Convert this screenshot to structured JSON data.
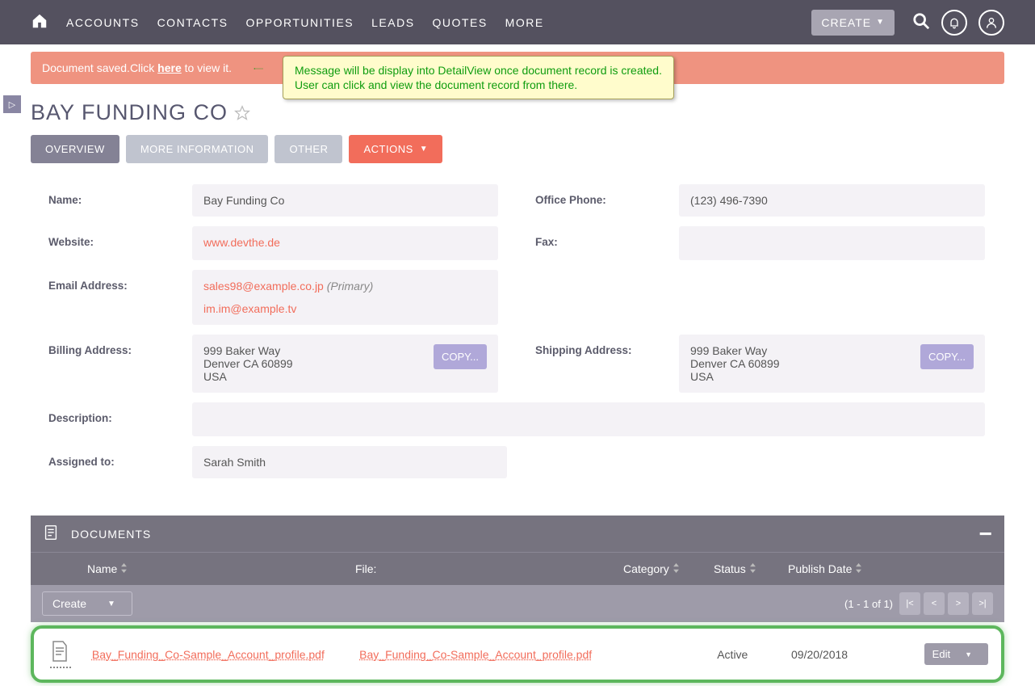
{
  "nav": {
    "accounts": "ACCOUNTS",
    "contacts": "CONTACTS",
    "opportunities": "OPPORTUNITIES",
    "leads": "LEADS",
    "quotes": "QUOTES",
    "more": "MORE",
    "create": "CREATE"
  },
  "alert": {
    "prefix": "Document saved.Click ",
    "here": "here",
    "suffix": " to view it."
  },
  "note": {
    "line1": "Message will be display into DetailView once document record is created.",
    "line2": "User can click and view the document record from there."
  },
  "page_title": "BAY FUNDING CO",
  "tabs": {
    "overview": "OVERVIEW",
    "more_info": "MORE INFORMATION",
    "other": "OTHER",
    "actions": "ACTIONS"
  },
  "labels": {
    "name": "Name:",
    "office_phone": "Office Phone:",
    "website": "Website:",
    "fax": "Fax:",
    "email": "Email Address:",
    "billing": "Billing Address:",
    "shipping": "Shipping Address:",
    "description": "Description:",
    "assigned": "Assigned to:",
    "copy": "COPY...",
    "primary": "(Primary)"
  },
  "values": {
    "name": "Bay Funding Co",
    "office_phone": "(123) 496-7390",
    "website": "www.devthe.de",
    "fax": "",
    "email1": "sales98@example.co.jp",
    "email2": "im.im@example.tv",
    "addr_l1": "999 Baker Way",
    "addr_l2": "Denver CA   60899",
    "addr_l3": "USA",
    "description": "",
    "assigned": "Sarah Smith"
  },
  "panel": {
    "title": "DOCUMENTS",
    "th_name": "Name",
    "th_file": "File:",
    "th_category": "Category",
    "th_status": "Status",
    "th_publish": "Publish Date",
    "create": "Create",
    "pager": "(1 - 1 of 1)",
    "first": "|<",
    "prev": "<",
    "next": ">",
    "last": ">|",
    "edit": "Edit"
  },
  "doc": {
    "name": "Bay_Funding_Co-Sample_Account_profile.pdf",
    "file": "Bay_Funding_Co-Sample_Account_profile.pdf",
    "category": "",
    "status": "Active",
    "publish": "09/20/2018"
  }
}
